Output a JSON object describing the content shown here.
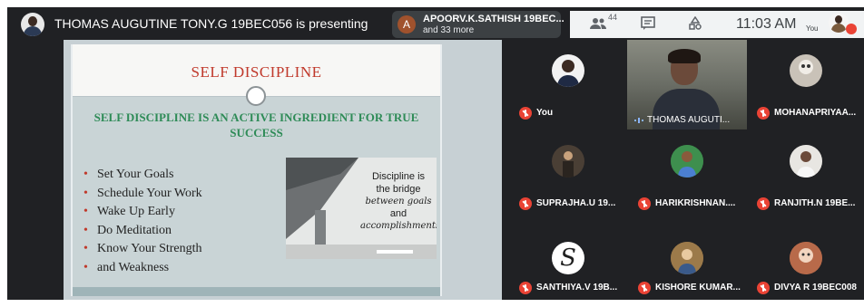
{
  "topbar": {
    "presenting_text": "THOMAS AUGUTINE TONY.G 19BEC056 is presenting",
    "chip_initial": "A",
    "chip_line1": "APOORV.K.SATHISH 19BEC...",
    "chip_line2": "and 33 more",
    "participant_count": "44",
    "time": "11:03 AM",
    "you_label": "You"
  },
  "slide": {
    "title": "SELF DISCIPLINE",
    "subtitle": "SELF DISCIPLINE IS AN ACTIVE INGREDIENT FOR TRUE SUCCESS",
    "bullets": [
      "Set Your Goals",
      "Schedule Your Work",
      "Wake Up Early",
      "Do Meditation",
      "Know Your Strength",
      "and Weakness"
    ],
    "quote_line1": "Discipline is",
    "quote_line2": "the bridge",
    "quote_line3": "between goals",
    "quote_line4": "and",
    "quote_line5": "accomplishments"
  },
  "participants": [
    {
      "name": "You"
    },
    {
      "name": "THOMAS AUGUTI..."
    },
    {
      "name": "MOHANAPRIYAA..."
    },
    {
      "name": "SUPRAJHA.U 19..."
    },
    {
      "name": "HARIKRISHNAN...."
    },
    {
      "name": "RANJITH.N 19BE..."
    },
    {
      "name": "SANTHIYA.V 19B..."
    },
    {
      "name": "KISHORE KUMAR..."
    },
    {
      "name": "DIVYA R 19BEC008"
    }
  ],
  "icons": [
    "presenter-avatar",
    "people-icon",
    "chat-icon",
    "activities-icon",
    "mic-off-icon",
    "sound-wave-icon"
  ],
  "colors": {
    "accent_red": "#ea4335",
    "slide_title": "#c0392b",
    "slide_subtitle": "#2e8b57",
    "background": "#202124"
  }
}
